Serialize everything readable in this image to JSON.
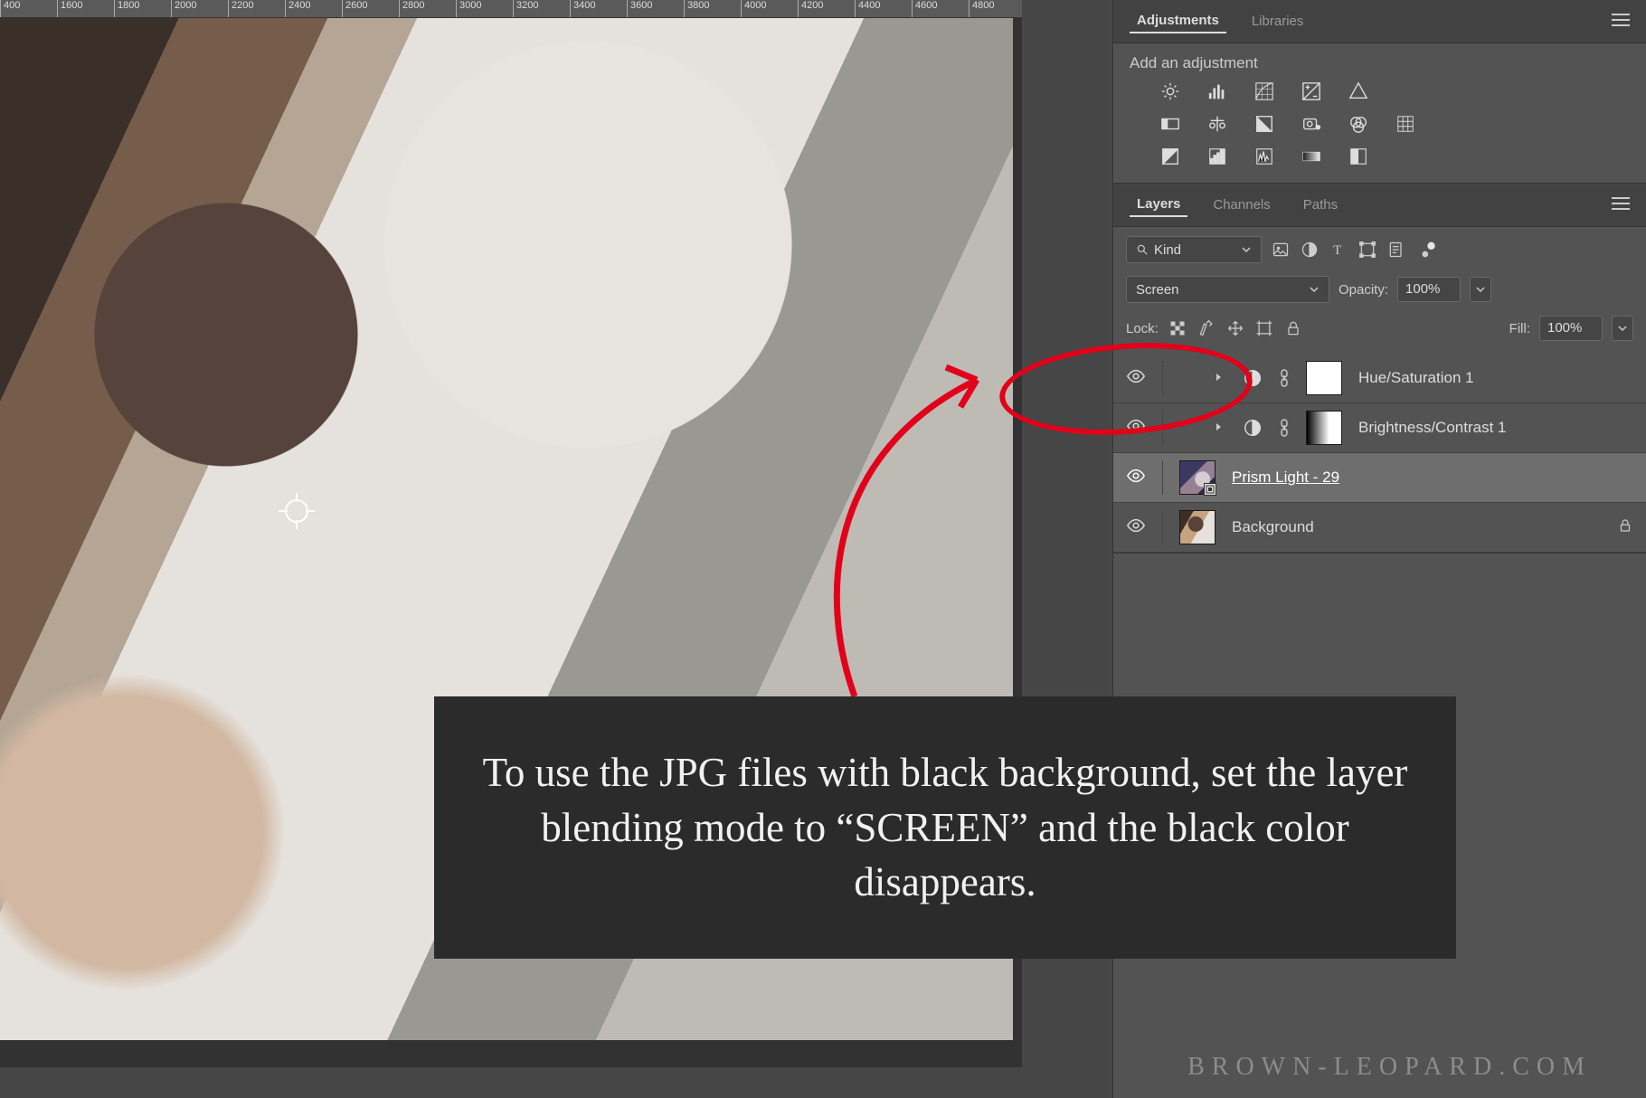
{
  "ruler_ticks": [
    "400",
    "1600",
    "1800",
    "2000",
    "2200",
    "2400",
    "2600",
    "2800",
    "3000",
    "3200",
    "3400",
    "3600",
    "3800",
    "4000",
    "4200",
    "4400",
    "4600",
    "4800"
  ],
  "adjustments": {
    "tab_adjustments": "Adjustments",
    "tab_libraries": "Libraries",
    "prompt": "Add an adjustment",
    "icons_row1": [
      "brightness",
      "levels",
      "curves",
      "exposure",
      "vibrance"
    ],
    "icons_row2": [
      "hue-sat",
      "color-balance",
      "bw",
      "photo-filter",
      "channel-mixer",
      "color-lookup"
    ],
    "icons_row3": [
      "invert",
      "posterize",
      "threshold",
      "gradient-map",
      "selective-color"
    ]
  },
  "layers": {
    "tab_layers": "Layers",
    "tab_channels": "Channels",
    "tab_paths": "Paths",
    "filter_label": "Kind",
    "blend_mode": "Screen",
    "opacity_label": "Opacity:",
    "opacity_value": "100%",
    "lock_label": "Lock:",
    "fill_label": "Fill:",
    "fill_value": "100%",
    "items": [
      {
        "name": "Hue/Saturation 1",
        "type": "adjustment"
      },
      {
        "name": "Brightness/Contrast 1",
        "type": "adjustment"
      },
      {
        "name": "Prism Light - 29",
        "type": "smart",
        "selected": true
      },
      {
        "name": "Background",
        "type": "image",
        "locked": true
      }
    ]
  },
  "annotation": {
    "text": "To use the JPG files with black background, set the layer blending mode to “SCREEN” and the black color disappears."
  },
  "watermark": "BROWN-LEOPARD.COM"
}
